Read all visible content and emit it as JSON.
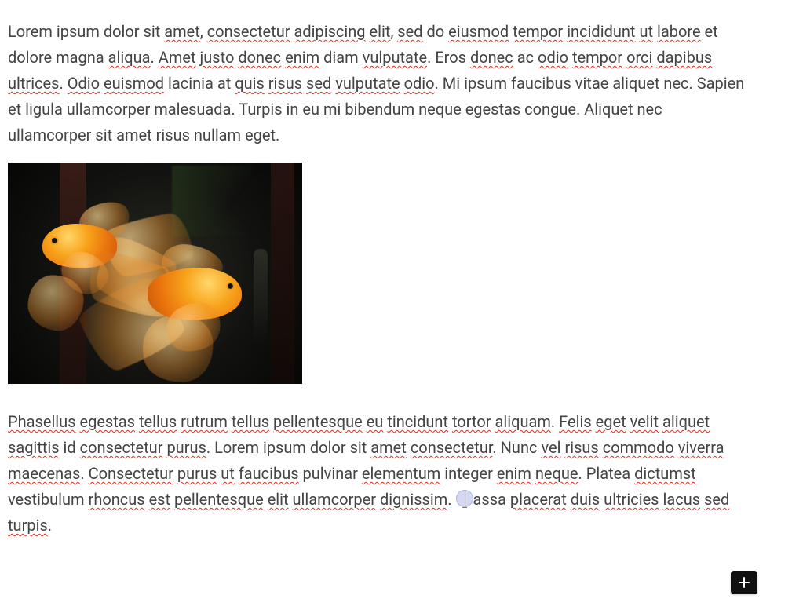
{
  "paragraphs": {
    "p1": {
      "full_text": "Lorem ipsum dolor sit amet, consectetur adipiscing elit, sed do eiusmod tempor incididunt ut labore et dolore magna aliqua. Amet justo donec enim diam vulputate. Eros donec ac odio tempor orci dapibus ultrices. Odio euismod lacinia at quis risus sed vulputate odio. Mi ipsum faucibus vitae aliquet nec. Sapien et ligula ullamcorper malesuada. Turpis in eu mi bibendum neque egestas congue. Aliquet nec ullamcorper sit amet risus nullam eget.",
      "w": {
        "lorem_intro": "Lorem ipsum dolor sit ",
        "amet": "amet",
        "comma1": ", ",
        "consectetur": "consectetur",
        "sp1": " ",
        "adipiscing": "adipiscing",
        "sp2": " ",
        "elit": "elit",
        "comma2": ", ",
        "sed": "sed",
        "sp3": " do ",
        "eiusmod": "eiusmod",
        "sp4": " ",
        "tempor": "tempor",
        "sp5": " ",
        "incididunt": "incididunt",
        "sp6": " ",
        "ut": "ut",
        "sp7": " ",
        "labore": "labore",
        "tail1": " et dolore magna ",
        "aliqua": "aliqua",
        "dot1": ". ",
        "amet2": "Amet",
        "sp8": " ",
        "justo": "justo",
        "sp9": " ",
        "donec": "donec",
        "sp10": " ",
        "enim": "enim",
        "sp11": " diam ",
        "vulputate": "vulputate",
        "dot2": ". Eros ",
        "donec2": "donec",
        "sp12": " ac ",
        "odio": "odio",
        "sp13": " ",
        "tempor2": "tempor",
        "sp14": " ",
        "orci": "orci",
        "sp15": " ",
        "dapibus": "dapibus",
        "sp16": " ",
        "ultrices": "ultrices",
        "dot3": ". ",
        "odio2": "Odio",
        "sp17": " ",
        "euismod": "euismod",
        "sp18": " lacinia at ",
        "quis": "quis",
        "sp19": " ",
        "risus": "risus",
        "sp20": " ",
        "sed2": "sed",
        "sp21": " ",
        "vulputate2": "vulputate",
        "sp22": " ",
        "odio3": "odio",
        "rest": ". Mi ipsum faucibus vitae aliquet nec. Sapien et ligula ullamcorper malesuada. Turpis in eu mi bibendum neque egestas congue. Aliquet nec ullamcorper sit amet risus nullam eget."
      }
    },
    "p2": {
      "full_text": "Phasellus egestas tellus rutrum tellus pellentesque eu tincidunt tortor aliquam. Felis eget velit aliquet sagittis id consectetur purus. Lorem ipsum dolor sit amet consectetur. Nunc vel risus commodo viverra maecenas. Consectetur purus ut faucibus pulvinar elementum integer enim neque. Platea dictumst vestibulum rhoncus est pellentesque elit ullamcorper dignissim. Massa placerat duis ultricies lacus sed turpis.",
      "w": {
        "phasellus": "Phasellus",
        "sp1": " ",
        "egestas": "egestas",
        "sp2": " ",
        "tellus": "tellus",
        "sp3": " ",
        "rutrum": "rutrum",
        "sp4": " ",
        "tellus2": "tellus",
        "sp5": " ",
        "pellentesque": "pellentesque",
        "sp6": " ",
        "eu": "eu",
        "sp7": " ",
        "tincidunt": "tincidunt",
        "sp8": " ",
        "tortor": "tortor",
        "sp9": " ",
        "aliquam": "aliquam",
        "dot1": ". ",
        "felis": "Felis",
        "sp10": " ",
        "eget": "eget",
        "sp11": " ",
        "velit": "velit",
        "sp12": " ",
        "aliquet": "aliquet",
        "sp13": " ",
        "sagittis": "sagittis",
        "sp14": " id ",
        "consectetur": "consectetur",
        "sp15": " ",
        "purus": "purus",
        "dot2": ". Lorem ipsum dolor sit ",
        "amet": "amet",
        "sp16": " ",
        "consectetur2": "consectetur",
        "dot3": ". Nunc ",
        "vel": "vel",
        "sp17": " ",
        "risus": "risus",
        "sp18": " ",
        "commodo": "commodo",
        "sp19": " ",
        "viverra": "viverra",
        "sp20": " ",
        "maecenas": "maecenas",
        "dot4": ". ",
        "consectetur3": "Consectetur",
        "sp21": " ",
        "purus2": "purus",
        "sp22": " ",
        "ut": "ut",
        "sp23": " ",
        "faucibus": "faucibus",
        "sp24": " pulvinar ",
        "elementum": "elementum",
        "sp25": " integer ",
        "enim": "enim",
        "sp26": " ",
        "neque": "neque",
        "dot5": ". Platea ",
        "dictumst": "dictumst",
        "sp27": " vestibulum ",
        "rhoncus": "rhoncus",
        "sp28": " ",
        "est": "est",
        "sp29": " ",
        "pellentesque2": "pellentesque",
        "sp30": " ",
        "elit": "elit",
        "sp31": " ",
        "ullamcorper": "ullamcorper",
        "sp32": " ",
        "dignissim": "dignissim",
        "dot6": ". ",
        "massa_tail": "assa ",
        "placerat": "placerat",
        "sp33": " ",
        "duis": "duis",
        "sp34": " ",
        "ultricies": "ultricies",
        "sp35": " ",
        "lacus": "lacus",
        "sp36": " ",
        "sed": "sed",
        "sp37": " ",
        "turpis": "turpis",
        "dot7": "."
      }
    }
  },
  "image": {
    "alt": "Two orange goldfish with flowing fins swimming in a dark aquarium"
  },
  "cursor": {
    "paragraph": 2,
    "within_word": "Massa",
    "char_after_cursor": "M"
  },
  "buttons": {
    "add_label": "Add"
  },
  "colors": {
    "text": "#444444",
    "spellcheck": "#d93025",
    "cursor_halo": "rgba(90,100,200,.25)",
    "add_button_bg": "#101010"
  }
}
